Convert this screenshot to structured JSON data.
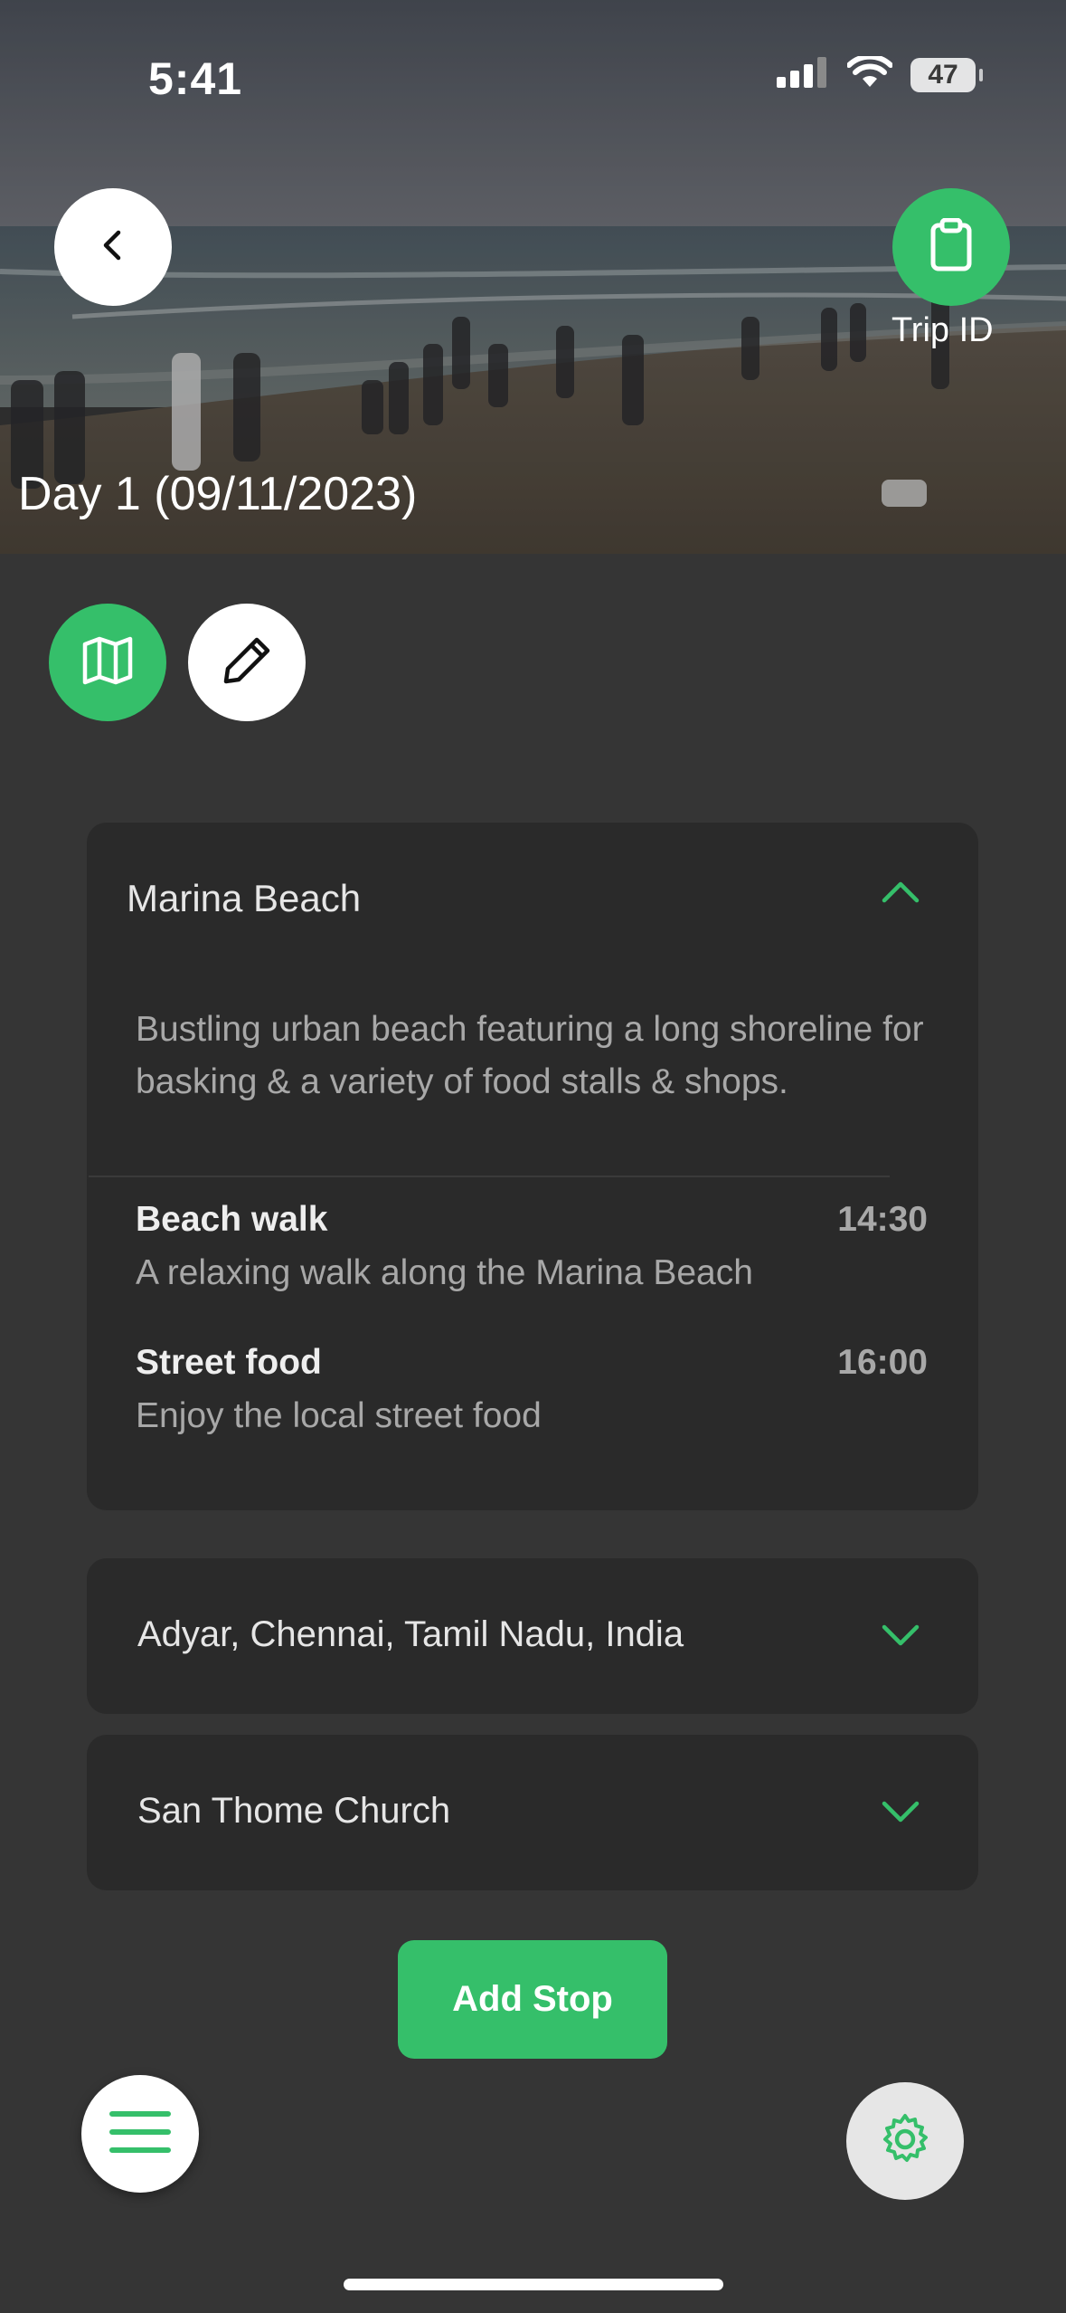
{
  "status_bar": {
    "time": "5:41",
    "battery": "47"
  },
  "header": {
    "back_icon": "chevron-left-icon",
    "trip_id_icon": "clipboard-icon",
    "trip_id_label": "Trip ID",
    "day_title": "Day 1 (09/11/2023)"
  },
  "actions": {
    "map_icon": "map-icon",
    "edit_icon": "pencil-icon"
  },
  "stops": [
    {
      "name": "Marina Beach",
      "expanded": true,
      "description": "Bustling urban beach featuring a long shoreline for basking & a variety of food stalls & shops.",
      "activities": [
        {
          "name": "Beach walk",
          "time": "14:30",
          "description": "A relaxing walk along the Marina Beach"
        },
        {
          "name": "Street food",
          "time": "16:00",
          "description": "Enjoy the local street food"
        }
      ]
    },
    {
      "name": "Adyar, Chennai, Tamil Nadu, India",
      "expanded": false
    },
    {
      "name": "San Thome Church",
      "expanded": false
    }
  ],
  "add_stop_label": "Add Stop",
  "bottom": {
    "menu_icon": "hamburger-menu-icon",
    "settings_icon": "gear-icon"
  },
  "colors": {
    "accent": "#35bf6a",
    "background": "#353535",
    "card": "#2a2a2a"
  }
}
